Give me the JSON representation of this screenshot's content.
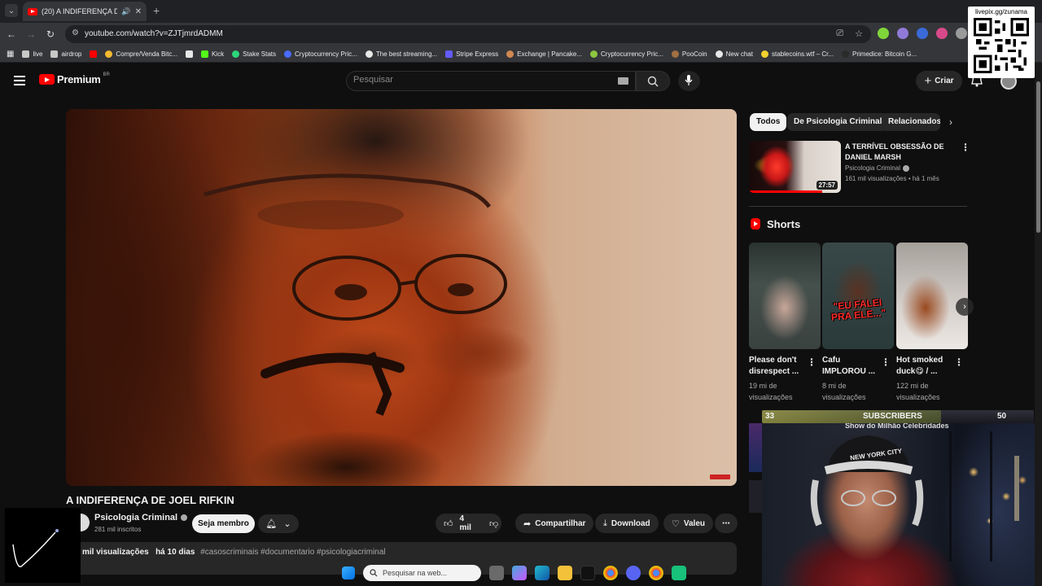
{
  "browser": {
    "tab_title": "(20) A INDIFERENÇA DE JOEL RIFKIN",
    "url": "youtube.com/watch?v=ZJTjmrdADMM",
    "bookmarks": [
      {
        "label": "live",
        "color": "#c8c8c8"
      },
      {
        "label": "airdrop",
        "color": "#c8c8c8"
      },
      {
        "label": "",
        "color": "#ff0000"
      },
      {
        "label": "Compre/Venda Bitc...",
        "color": "#f3ba2f"
      },
      {
        "label": "",
        "color": "#e8e8e8"
      },
      {
        "label": "Kick",
        "color": "#53fc18"
      },
      {
        "label": "Stake Stats",
        "color": "#2bd67b"
      },
      {
        "label": "Cryptocurrency Pric...",
        "color": "#4a6bff"
      },
      {
        "label": "The best streaming...",
        "color": "#e8e8e8"
      },
      {
        "label": "Stripe Express",
        "color": "#635bff"
      },
      {
        "label": "Exchange | Pancake...",
        "color": "#d1884f"
      },
      {
        "label": "Cryptocurrency Pric...",
        "color": "#8dc63f"
      },
      {
        "label": "PooCoin",
        "color": "#a07040"
      },
      {
        "label": "New chat",
        "color": "#e8e8e8"
      },
      {
        "label": "stablecoins.wtf – Cr...",
        "color": "#f3d02f"
      },
      {
        "label": "Primedice: Bitcoin G...",
        "color": "#2a2a2a"
      }
    ]
  },
  "overlay": {
    "qr_label": "livepix.gg/zunama",
    "sub_goal": {
      "current": "33",
      "label": "SUBSCRIBERS",
      "target": "50",
      "progress": 0.66
    }
  },
  "header": {
    "logo_text": "Premium",
    "logo_country": "BR",
    "search_placeholder": "Pesquisar",
    "create_label": "Criar"
  },
  "video": {
    "title": "A INDIFERENÇA DE JOEL RIFKIN",
    "channel": "Psicologia Criminal",
    "subscribers": "281 mil inscritos",
    "member_label": "Seja membro",
    "likes": "4 mil",
    "share_label": "Compartilhar",
    "download_label": "Download",
    "thanks_label": "Valeu",
    "views": "mil visualizações",
    "age": "há 10 dias",
    "tags": "#casoscriminais #documentario #psicologiacriminal"
  },
  "chips": [
    "Todos",
    "De Psicologia Criminal",
    "Relacionados"
  ],
  "recommendation": {
    "title": "A TERRÍVEL OBSESSÃO DE DANIEL MARSH",
    "channel": "Psicologia Criminal",
    "meta": "161 mil visualizações • há 1 mês",
    "duration": "27:57"
  },
  "shorts": {
    "heading": "Shorts",
    "items": [
      {
        "title": "Please don't disrespect ...",
        "views": "19 mi de visualizações",
        "overlay": ""
      },
      {
        "title": "Cafu IMPLOROU ...",
        "views": "8 mi de visualizações",
        "overlay": "\"EU FALEI PRA ELE...\""
      },
      {
        "title": "Hot smoked duck😋 / ...",
        "views": "122 mi de visualizações",
        "overlay": ""
      }
    ]
  },
  "partial_next_title": "Show do Milhão Celebridades",
  "webcam_cap_text": "NEW YORK CITY",
  "taskbar": {
    "search_placeholder": "Pesquisar na web..."
  }
}
